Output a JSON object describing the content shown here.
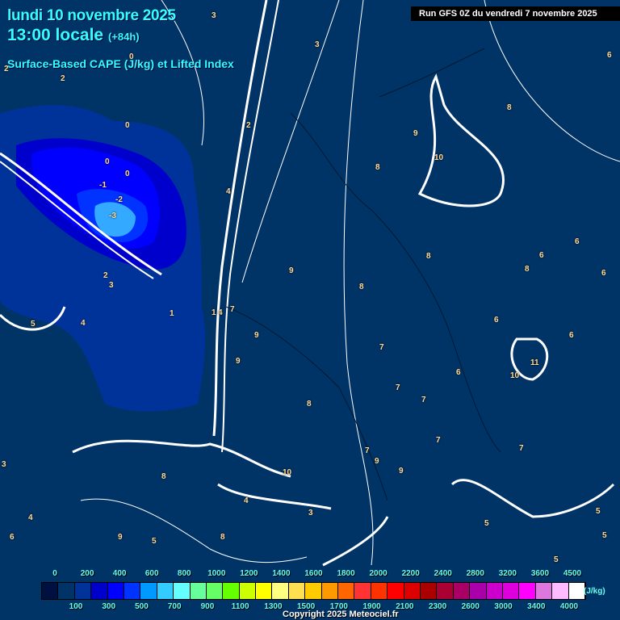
{
  "header": {
    "date": "lundi 10 novembre 2025",
    "time": "13:00 locale",
    "lead": "(+84h)",
    "product": "Surface-Based CAPE (J/kg) et Lifted Index",
    "run": "Run GFS 0Z du vendredi 7 novembre 2025"
  },
  "legend": {
    "top_labels": [
      "0",
      "200",
      "400",
      "600",
      "800",
      "1000",
      "1200",
      "1400",
      "1600",
      "1800",
      "2000",
      "2200",
      "2400",
      "2800",
      "3200",
      "3600",
      "4500"
    ],
    "bottom_labels": [
      "100",
      "300",
      "500",
      "700",
      "900",
      "1100",
      "1300",
      "1500",
      "1700",
      "1900",
      "2100",
      "2300",
      "2600",
      "3000",
      "3400",
      "4000"
    ],
    "unit": "(J/kg)",
    "colors": [
      "#001040",
      "#003366",
      "#003399",
      "#0000cc",
      "#0000ff",
      "#0033ff",
      "#0099ff",
      "#33ccff",
      "#66ffff",
      "#66ff99",
      "#66ff66",
      "#66ff00",
      "#ccff00",
      "#ffff00",
      "#ffff80",
      "#ffe050",
      "#ffcc00",
      "#ff9900",
      "#ff6600",
      "#ff3333",
      "#ff3300",
      "#ff0000",
      "#dd0000",
      "#aa0000",
      "#aa0033",
      "#aa0066",
      "#aa00aa",
      "#cc00cc",
      "#dd00dd",
      "#ff00ff",
      "#dd77dd",
      "#ffbbff",
      "#ffffff"
    ]
  },
  "lifted_index_labels": [
    "0",
    "0",
    "2",
    "2",
    "3",
    "3",
    "2",
    "0",
    "0",
    "-1",
    "-2",
    "-3",
    "1",
    "4",
    "2",
    "3",
    "5",
    "4",
    "1",
    "4",
    "7",
    "9",
    "9",
    "8",
    "9",
    "8",
    "7",
    "7",
    "6",
    "7",
    "8",
    "7",
    "9",
    "10",
    "9",
    "8",
    "6",
    "6",
    "6",
    "8",
    "9",
    "10",
    "10",
    "11",
    "6",
    "7",
    "6",
    "5",
    "5",
    "5",
    "5",
    "4",
    "3",
    "3",
    "4",
    "6",
    "9",
    "8",
    "8",
    "5",
    "6",
    "7",
    "8"
  ],
  "copyright": "Copyright 2025 Meteociel.fr"
}
